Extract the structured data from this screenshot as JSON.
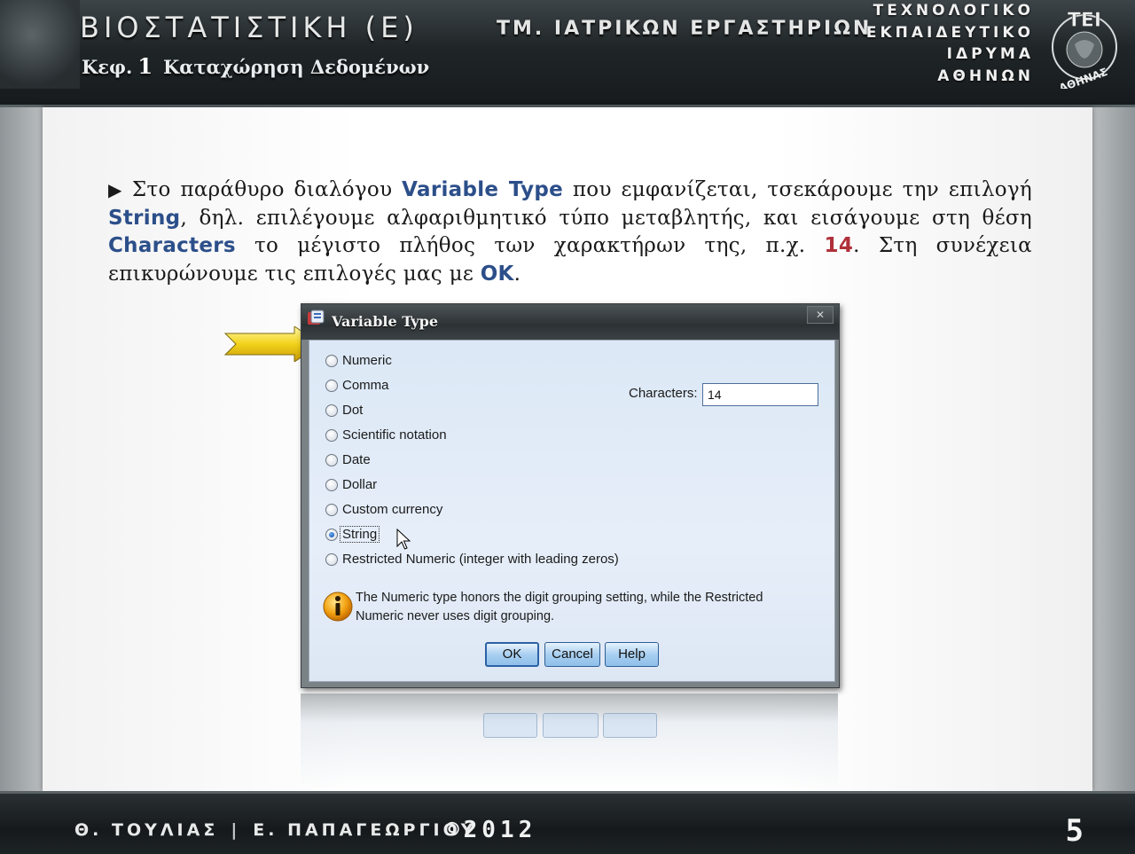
{
  "header": {
    "course_title": "ΒΙΟΣΤΑΤΙΣΤΙΚΗ (Ε)",
    "chapter_prefix": "Κεφ.",
    "chapter_number": "1",
    "chapter_title": "Καταχώρηση Δεδομένων",
    "department": "ΤΜ. ΙΑΤΡΙΚΩΝ ΕΡΓΑΣΤΗΡΙΩΝ",
    "institution_lines": [
      "ΤΕΧΝΟΛΟΓΙΚΟ",
      "ΕΚΠΑΙΔΕΥΤΙΚΟ",
      "ΙΔΡΥΜΑ",
      "ΑΘΗΝΩΝ"
    ],
    "logo_text_top": "ΤΕΙ",
    "logo_text_bottom": "ΑΘΗΝΑΣ"
  },
  "description": {
    "p1": "Στο παράθυρο διαλόγου ",
    "kw1": "Variable Type",
    "p2": " που εμφανίζεται, τσεκάρουμε την επιλογή ",
    "kw2": "String",
    "p3": ", δηλ. επιλέγουμε αλφαριθμητικό τύπο μεταβλητής, και εισάγουμε στη θέση ",
    "kw3": "Characters",
    "p4": " το μέγιστο πλήθος των χαρακτήρων της, π.χ. ",
    "val": "14",
    "p5": ". Στη συνέχεια επικυρώνουμε τις επιλογές μας με ",
    "kw4": "OK",
    "p6": "."
  },
  "dialog": {
    "title": "Variable Type",
    "close_label": "✕",
    "options": [
      {
        "label": "Numeric",
        "checked": false
      },
      {
        "label": "Comma",
        "checked": false
      },
      {
        "label": "Dot",
        "checked": false
      },
      {
        "label": "Scientific notation",
        "checked": false
      },
      {
        "label": "Date",
        "checked": false
      },
      {
        "label": "Dollar",
        "checked": false
      },
      {
        "label": "Custom currency",
        "checked": false
      },
      {
        "label": "String",
        "checked": true
      },
      {
        "label": "Restricted Numeric (integer with leading zeros)",
        "checked": false
      }
    ],
    "characters_label": "Characters:",
    "characters_value": "14",
    "info_text": "The Numeric type honors the digit grouping setting, while the Restricted Numeric never uses digit grouping.",
    "buttons": {
      "ok": "OK",
      "cancel": "Cancel",
      "help": "Help"
    }
  },
  "footer": {
    "author1": "Θ. ΤΟΥΛΙΑΣ",
    "separator": "|",
    "author2": "Ε. ΠΑΠΑΓΕΩΡΓΙΟΥ",
    "copyright": "©2012",
    "page_number": "5"
  },
  "colors": {
    "keyword": "#2c4f8a",
    "value": "#b0303a",
    "dialog_body": "#dce8f6"
  }
}
